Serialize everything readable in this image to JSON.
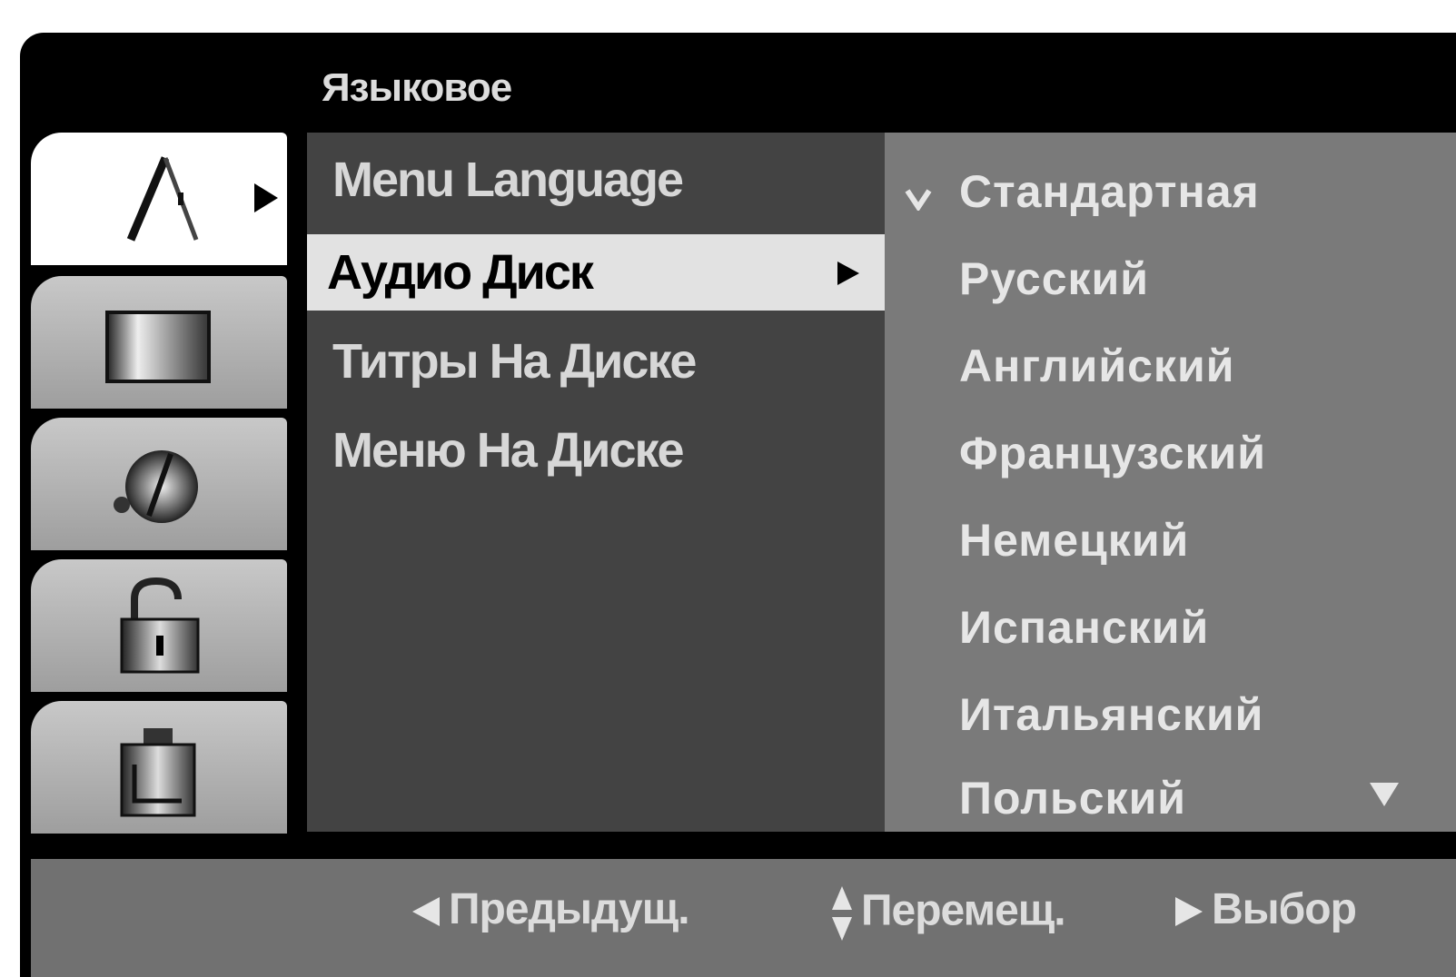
{
  "header": {
    "title": "Языковое"
  },
  "tabs": [
    {
      "icon": "language-icon",
      "active": true
    },
    {
      "icon": "display-icon",
      "active": false
    },
    {
      "icon": "audio-icon",
      "active": false
    },
    {
      "icon": "lock-icon",
      "active": false
    },
    {
      "icon": "others-icon",
      "active": false
    }
  ],
  "menu": {
    "items": [
      {
        "label": "Menu Language"
      },
      {
        "label": "Аудио Диск"
      },
      {
        "label": "Титры На Диске"
      },
      {
        "label": "Меню На Диске"
      }
    ],
    "selected_index": 1
  },
  "options": {
    "items": [
      {
        "label": "Стандартная"
      },
      {
        "label": "Русский"
      },
      {
        "label": "Английский"
      },
      {
        "label": "Французский"
      },
      {
        "label": "Немецкий"
      },
      {
        "label": "Испанский"
      },
      {
        "label": "Итальянский"
      },
      {
        "label": "Польский"
      }
    ],
    "checked_index": 0,
    "check_icon": "checkmark-icon",
    "scroll_icon": "scroll-down-icon"
  },
  "footer": {
    "prev_label": "Предыдущ.",
    "move_label": "Перемещ.",
    "select_label": "Выбор"
  },
  "colors": {
    "background": "#000000",
    "menu_panel": "#434343",
    "options_panel": "#7a7a7a",
    "selected_row": "#e2e2e2",
    "footer": "#717171"
  }
}
